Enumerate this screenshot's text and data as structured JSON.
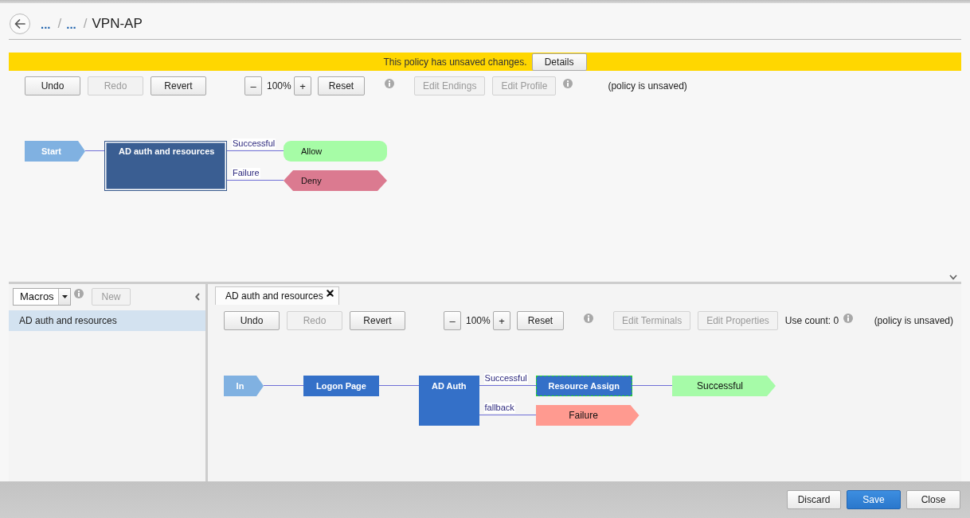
{
  "header": {
    "breadcrumb": {
      "separator": "/",
      "items": [
        {
          "label": "...",
          "kind": "link"
        },
        {
          "label": "...",
          "kind": "link"
        },
        {
          "label": "VPN-AP",
          "kind": "current"
        }
      ]
    }
  },
  "banner": {
    "message": "This policy has unsaved changes.",
    "button": "Details"
  },
  "policy_toolbar": {
    "history": [
      {
        "label": "Undo",
        "disabled": false
      },
      {
        "label": "Redo",
        "disabled": true
      },
      {
        "label": "Revert",
        "disabled": false
      }
    ],
    "zoom": {
      "zoom_out": "–",
      "value": "100%",
      "zoom_in": "+",
      "reset": "Reset"
    },
    "edit": [
      {
        "label": "Edit Endings",
        "disabled": true
      },
      {
        "label": "Edit Profile",
        "disabled": true
      }
    ],
    "status": "(policy is unsaved)"
  },
  "policy_diagram": {
    "root": {
      "kind": "start",
      "label": "Start",
      "selected": false,
      "branches": [
        {
          "node": {
            "kind": "macrocall",
            "label": "AD auth and resources",
            "selected": false,
            "branches": [
              {
                "label": "Successful",
                "node": {
                  "kind": "allow",
                  "label": "Allow",
                  "color": "#a6fca6",
                  "selected": false
                }
              },
              {
                "label": "Failure",
                "node": {
                  "kind": "deny",
                  "label": "Deny",
                  "color": "#db7a90",
                  "selected": false
                }
              }
            ]
          }
        }
      ]
    }
  },
  "macros_panel": {
    "filter": "Macros",
    "new_button": {
      "label": "New",
      "disabled": true
    },
    "items": [
      {
        "label": "AD auth and resources",
        "selected": true
      }
    ]
  },
  "macro_editor": {
    "tabs": [
      {
        "label": "AD auth and resources",
        "selected": true
      }
    ],
    "toolbar": {
      "history": [
        {
          "label": "Undo",
          "disabled": false
        },
        {
          "label": "Redo",
          "disabled": true
        },
        {
          "label": "Revert",
          "disabled": false
        }
      ],
      "zoom": {
        "zoom_out": "–",
        "value": "100%",
        "zoom_in": "+",
        "reset": "Reset"
      },
      "edit": [
        {
          "label": "Edit Terminals",
          "disabled": true
        },
        {
          "label": "Edit Properties",
          "disabled": true
        }
      ],
      "use_count": "Use count: 0",
      "status": "(policy is unsaved)"
    },
    "diagram": {
      "root": {
        "kind": "in",
        "label": "In",
        "selected": false,
        "branches": [
          {
            "node": {
              "kind": "action",
              "label": "Logon Page",
              "selected": false,
              "branches": [
                {
                  "node": {
                    "kind": "action",
                    "label": "AD Auth",
                    "selected": false,
                    "branches": [
                      {
                        "label": "Successful",
                        "node": {
                          "kind": "action",
                          "label": "Resource Assign",
                          "selected": true,
                          "branches": [
                            {
                              "node": {
                                "kind": "terminal",
                                "label": "Successful",
                                "color": "#a6fba8",
                                "selected": false
                              }
                            }
                          ]
                        }
                      },
                      {
                        "label": "fallback",
                        "node": {
                          "kind": "terminal",
                          "label": "Failure",
                          "color": "#ff9a90",
                          "selected": false
                        }
                      }
                    ]
                  }
                }
              ]
            }
          }
        ]
      }
    }
  },
  "footer": {
    "buttons": [
      {
        "label": "Discard",
        "kind": "default"
      },
      {
        "label": "Save",
        "kind": "primary"
      },
      {
        "label": "Close",
        "kind": "default"
      }
    ]
  }
}
